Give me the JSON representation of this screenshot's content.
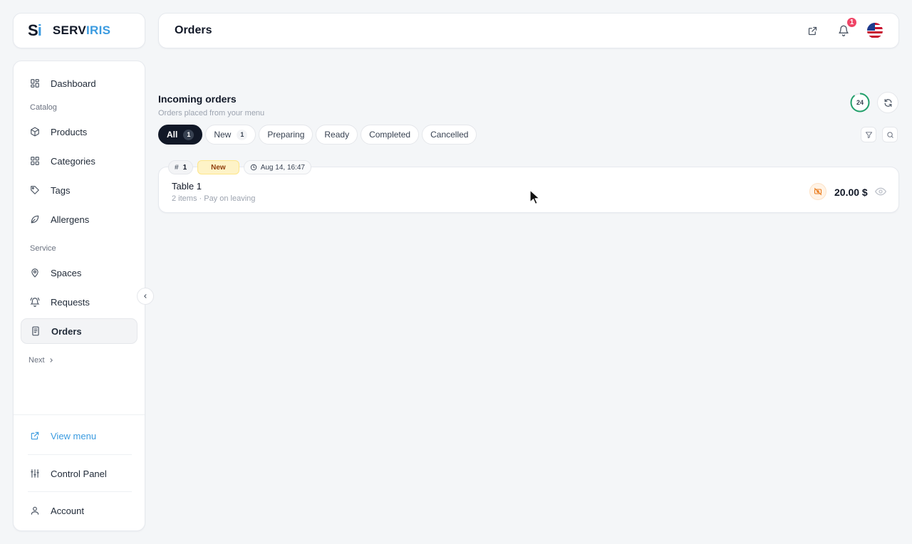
{
  "brand": {
    "mark_s": "S",
    "mark_i": "i",
    "name_a": "SERV",
    "name_b": "IRIS",
    "accent": "#3b9be0"
  },
  "header": {
    "title": "Orders",
    "notification_count": "1"
  },
  "sidebar": {
    "dashboard": "Dashboard",
    "catalog_label": "Catalog",
    "products": "Products",
    "categories": "Categories",
    "tags": "Tags",
    "allergens": "Allergens",
    "service_label": "Service",
    "spaces": "Spaces",
    "requests": "Requests",
    "orders": "Orders",
    "next": "Next",
    "view_menu": "View menu",
    "control_panel": "Control Panel",
    "account": "Account"
  },
  "main": {
    "title": "Incoming orders",
    "subtitle": "Orders placed from your menu",
    "auto_refresh_seconds": "24",
    "tabs": [
      {
        "label": "All",
        "count": "1",
        "active": true
      },
      {
        "label": "New",
        "count": "1"
      },
      {
        "label": "Preparing"
      },
      {
        "label": "Ready"
      },
      {
        "label": "Completed"
      },
      {
        "label": "Cancelled"
      }
    ]
  },
  "order": {
    "number_prefix": "#",
    "number": "1",
    "status": "New",
    "time": "Aug 14, 16:47",
    "table": "Table 1",
    "meta": "2 items · Pay on leaving",
    "total": "20.00 $"
  },
  "colors": {
    "dark": "#111827",
    "new_badge": "#fef3c7",
    "unpaid": "#ea7a1a",
    "ring": "#22a06b"
  }
}
